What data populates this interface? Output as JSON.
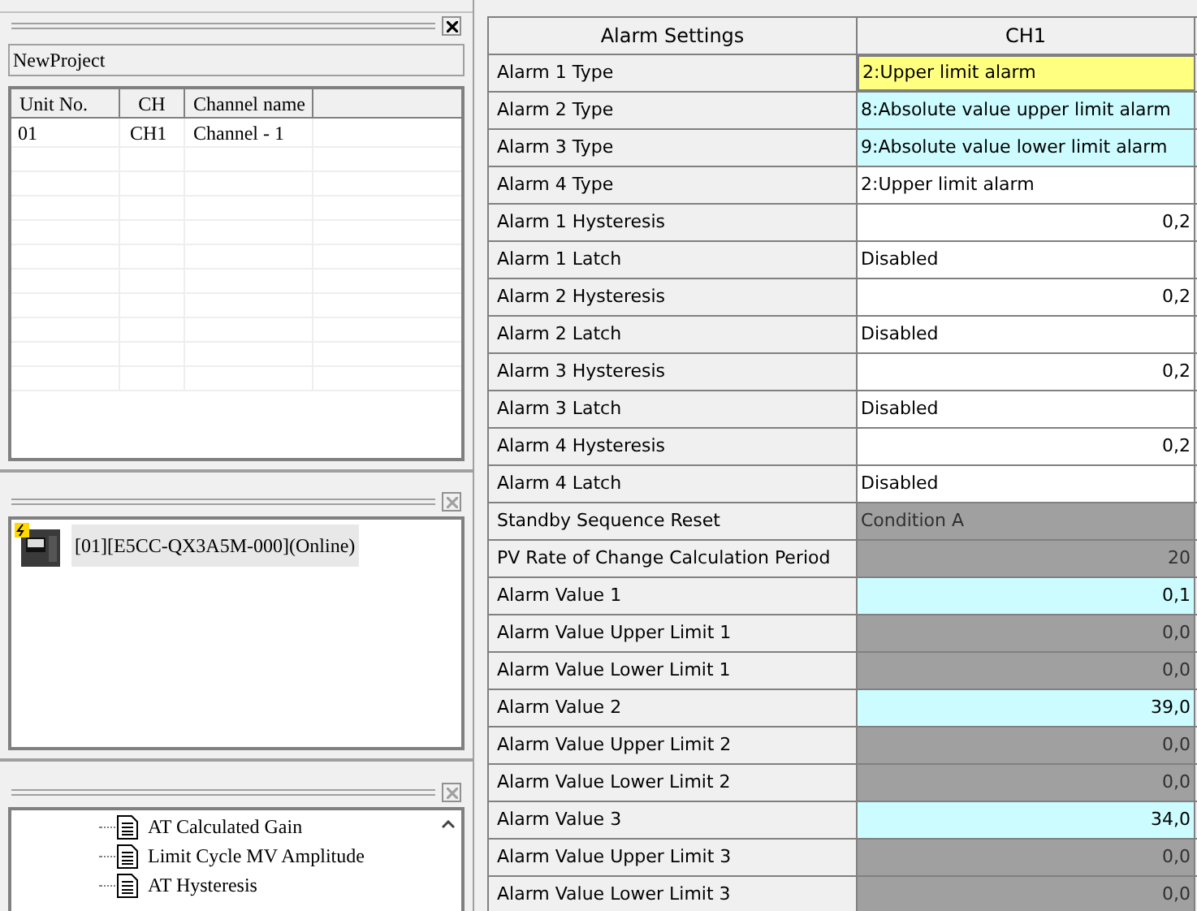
{
  "project": {
    "name": "NewProject"
  },
  "unit_table": {
    "columns": [
      "Unit No.",
      "CH",
      "Channel name"
    ],
    "rows": [
      [
        "01",
        "CH1",
        "Channel - 1"
      ]
    ]
  },
  "device": {
    "label": "[01][E5CC-QX3A5M-000](Online)",
    "online": true
  },
  "tree": {
    "items": [
      {
        "label": "AT Calculated Gain"
      },
      {
        "label": "Limit Cycle MV Amplitude"
      },
      {
        "label": "AT Hysteresis"
      }
    ]
  },
  "settings": {
    "columns": [
      "Alarm Settings",
      "CH1"
    ],
    "rows": [
      {
        "label": "Alarm 1 Type",
        "value": "2:Upper limit alarm",
        "kind": "text",
        "selected": true
      },
      {
        "label": "Alarm 2 Type",
        "value": "8:Absolute value upper limit alarm",
        "kind": "text",
        "selected": false,
        "disabled": false,
        "changed": true
      },
      {
        "label": "Alarm 3 Type",
        "value": "9:Absolute value lower limit alarm",
        "kind": "text",
        "selected": false,
        "disabled": false,
        "changed": true
      },
      {
        "label": "Alarm 4 Type",
        "value": "2:Upper limit alarm",
        "kind": "text",
        "selected": false,
        "disabled": false,
        "changed": false
      },
      {
        "label": "Alarm 1 Hysteresis",
        "value": "0,2",
        "kind": "number",
        "selected": false,
        "disabled": false,
        "changed": false
      },
      {
        "label": "Alarm 1 Latch",
        "value": "Disabled",
        "kind": "text",
        "selected": false,
        "disabled": false,
        "changed": false
      },
      {
        "label": "Alarm 2 Hysteresis",
        "value": "0,2",
        "kind": "number",
        "selected": false,
        "disabled": false,
        "changed": false
      },
      {
        "label": "Alarm 2 Latch",
        "value": "Disabled",
        "kind": "text",
        "selected": false,
        "disabled": false,
        "changed": false
      },
      {
        "label": "Alarm 3 Hysteresis",
        "value": "0,2",
        "kind": "number",
        "selected": false,
        "disabled": false,
        "changed": false
      },
      {
        "label": "Alarm 3 Latch",
        "value": "Disabled",
        "kind": "text",
        "selected": false,
        "disabled": false,
        "changed": false
      },
      {
        "label": "Alarm 4 Hysteresis",
        "value": "0,2",
        "kind": "number",
        "selected": false,
        "disabled": false,
        "changed": false
      },
      {
        "label": "Alarm 4 Latch",
        "value": "Disabled",
        "kind": "text",
        "selected": false,
        "disabled": false,
        "changed": false
      },
      {
        "label": "Standby Sequence Reset",
        "value": "Condition A",
        "kind": "text",
        "selected": false,
        "disabled": true
      },
      {
        "label": "PV Rate of Change Calculation Period",
        "value": "20",
        "kind": "number",
        "selected": false,
        "disabled": true
      },
      {
        "label": "Alarm Value 1",
        "value": "0,1",
        "kind": "number",
        "selected": false,
        "disabled": false,
        "changed": true
      },
      {
        "label": "Alarm Value Upper Limit 1",
        "value": "0,0",
        "kind": "number",
        "selected": false,
        "disabled": true
      },
      {
        "label": "Alarm Value Lower Limit 1",
        "value": "0,0",
        "kind": "number",
        "selected": false,
        "disabled": true
      },
      {
        "label": "Alarm Value 2",
        "value": "39,0",
        "kind": "number",
        "selected": false,
        "disabled": false,
        "changed": true
      },
      {
        "label": "Alarm Value Upper Limit 2",
        "value": "0,0",
        "kind": "number",
        "selected": false,
        "disabled": true
      },
      {
        "label": "Alarm Value Lower Limit 2",
        "value": "0,0",
        "kind": "number",
        "selected": false,
        "disabled": true
      },
      {
        "label": "Alarm Value 3",
        "value": "34,0",
        "kind": "number",
        "selected": false,
        "disabled": false,
        "changed": true
      },
      {
        "label": "Alarm Value Upper Limit 3",
        "value": "0,0",
        "kind": "number",
        "selected": false,
        "disabled": true
      },
      {
        "label": "Alarm Value Lower Limit 3",
        "value": "0,0",
        "kind": "number",
        "selected": false,
        "disabled": true
      }
    ]
  }
}
